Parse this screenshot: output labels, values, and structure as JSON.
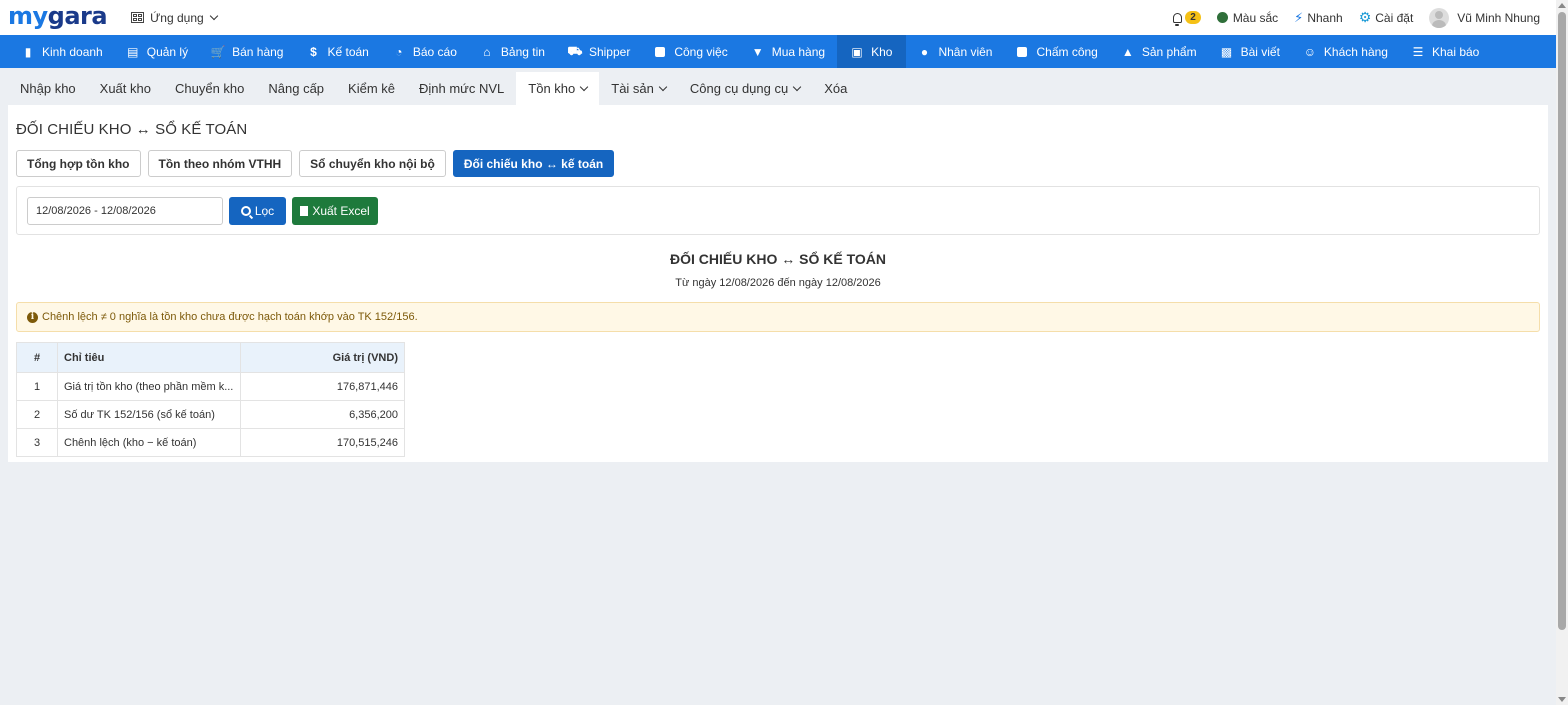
{
  "header": {
    "logo_my": "my",
    "logo_gara": "gara",
    "apps_label": "Ứng dụng",
    "notification_count": "2",
    "color_label": "Màu sắc",
    "quick_label": "Nhanh",
    "settings_label": "Cài đặt",
    "user_name": "Vũ Minh Nhung"
  },
  "main_nav": [
    {
      "label": "Kinh doanh",
      "icon": "bag-icon"
    },
    {
      "label": "Quản lý",
      "icon": "id-card-icon"
    },
    {
      "label": "Bán hàng",
      "icon": "cart-icon"
    },
    {
      "label": "Kế toán",
      "icon": "dollar-icon"
    },
    {
      "label": "Báo cáo",
      "icon": "pie-chart-icon"
    },
    {
      "label": "Bảng tin",
      "icon": "home-icon"
    },
    {
      "label": "Shipper",
      "icon": "truck-icon"
    },
    {
      "label": "Công việc",
      "icon": "calendar-icon"
    },
    {
      "label": "Mua hàng",
      "icon": "basket-icon"
    },
    {
      "label": "Kho",
      "icon": "warehouse-icon",
      "active": true
    },
    {
      "label": "Nhân viên",
      "icon": "user-icon"
    },
    {
      "label": "Chấm công",
      "icon": "calendar-icon"
    },
    {
      "label": "Sản phẩm",
      "icon": "cube-icon"
    },
    {
      "label": "Bài viết",
      "icon": "newspaper-icon"
    },
    {
      "label": "Khách hàng",
      "icon": "smile-icon"
    },
    {
      "label": "Khai báo",
      "icon": "list-icon"
    }
  ],
  "sub_nav": [
    {
      "label": "Nhập kho"
    },
    {
      "label": "Xuất kho"
    },
    {
      "label": "Chuyển kho"
    },
    {
      "label": "Nâng cấp"
    },
    {
      "label": "Kiểm kê"
    },
    {
      "label": "Định mức NVL"
    },
    {
      "label": "Tồn kho",
      "dropdown": true,
      "active": true
    },
    {
      "label": "Tài sản",
      "dropdown": true
    },
    {
      "label": "Công cụ dụng cụ",
      "dropdown": true
    },
    {
      "label": "Xóa"
    }
  ],
  "page": {
    "title": "ĐỐI CHIẾU KHO ↔ SỔ KẾ TOÁN",
    "report_buttons": [
      {
        "label": "Tổng hợp tồn kho"
      },
      {
        "label": "Tồn theo nhóm VTHH"
      },
      {
        "label": "Sổ chuyển kho nội bộ"
      },
      {
        "label": "Đối chiếu kho ↔ kế toán",
        "active": true
      }
    ],
    "filter": {
      "date_range": "12/08/2026 - 12/08/2026",
      "filter_label": "Lọc",
      "excel_label": "Xuất Excel"
    },
    "report_title": "ĐỐI CHIẾU KHO ↔ SỔ KẾ TOÁN",
    "report_subtitle": "Từ ngày 12/08/2026 đến ngày 12/08/2026",
    "alert": "Chênh lệch ≠ 0 nghĩa là tồn kho chưa được hạch toán khớp vào TK 152/156.",
    "table": {
      "headers": {
        "no": "#",
        "name": "Chỉ tiêu",
        "value": "Giá trị (VND)"
      },
      "rows": [
        {
          "no": "1",
          "name": "Giá trị tồn kho (theo phần mềm k...",
          "value": "176,871,446"
        },
        {
          "no": "2",
          "name": "Số dư TK 152/156 (sổ kế toán)",
          "value": "6,356,200"
        },
        {
          "no": "3",
          "name": "Chênh lệch (kho − kế toán)",
          "value": "170,515,246"
        }
      ]
    }
  },
  "colors": {
    "primary_blue": "#1b78e2",
    "active_blue": "#1565c0",
    "excel_green": "#1e7a3c",
    "alert_bg": "#fff8e6"
  }
}
